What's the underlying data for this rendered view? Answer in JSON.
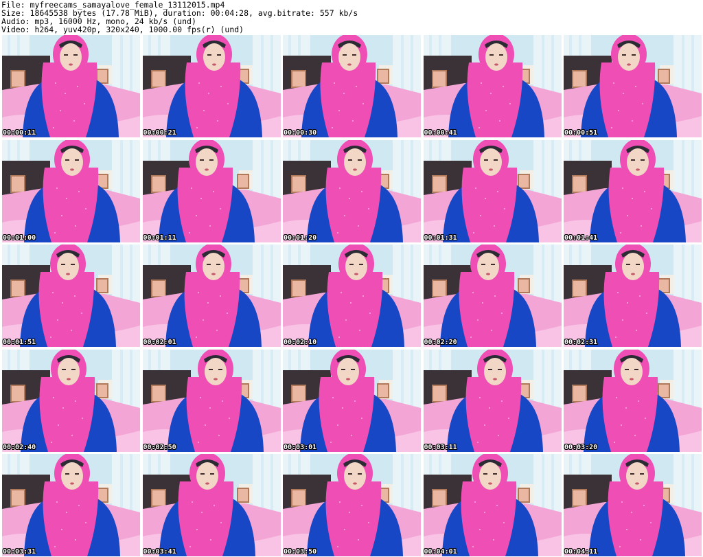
{
  "header": {
    "file_line": "File: myfreecams_samayalove_female_13112015.mp4",
    "size_line": "Size: 18645538 bytes (17.78 MiB), duration: 00:04:28, avg.bitrate: 557 kb/s",
    "audio_line": "Audio: mp3, 16000 Hz, mono, 24 kb/s (und)",
    "video_line": "Video: h264, yuv420p, 320x240, 1000.00 fps(r) (und)"
  },
  "frames": [
    {
      "time": "00:00:11"
    },
    {
      "time": "00:00:21"
    },
    {
      "time": "00:00:30"
    },
    {
      "time": "00:00:41"
    },
    {
      "time": "00:00:51"
    },
    {
      "time": "00:01:00"
    },
    {
      "time": "00:01:11"
    },
    {
      "time": "00:01:20"
    },
    {
      "time": "00:01:31"
    },
    {
      "time": "00:01:41"
    },
    {
      "time": "00:01:51"
    },
    {
      "time": "00:02:01"
    },
    {
      "time": "00:02:10"
    },
    {
      "time": "00:02:20"
    },
    {
      "time": "00:02:31"
    },
    {
      "time": "00:02:40"
    },
    {
      "time": "00:02:50"
    },
    {
      "time": "00:03:01"
    },
    {
      "time": "00:03:11"
    },
    {
      "time": "00:03:20"
    },
    {
      "time": "00:03:31"
    },
    {
      "time": "00:03:41"
    },
    {
      "time": "00:03:50"
    },
    {
      "time": "00:04:01"
    },
    {
      "time": "00:04:11"
    }
  ],
  "colors": {
    "background": "#ffffff",
    "wall": "#cfe8f2",
    "curtain": "#e8f4f8",
    "headboard": "#3a3236",
    "bedsheet": "#f3a6d6",
    "sweater": "#1747c4",
    "scarf": "#ef4fb4",
    "skin": "#f2d6c6",
    "timestamp_text": "#ffffff"
  }
}
